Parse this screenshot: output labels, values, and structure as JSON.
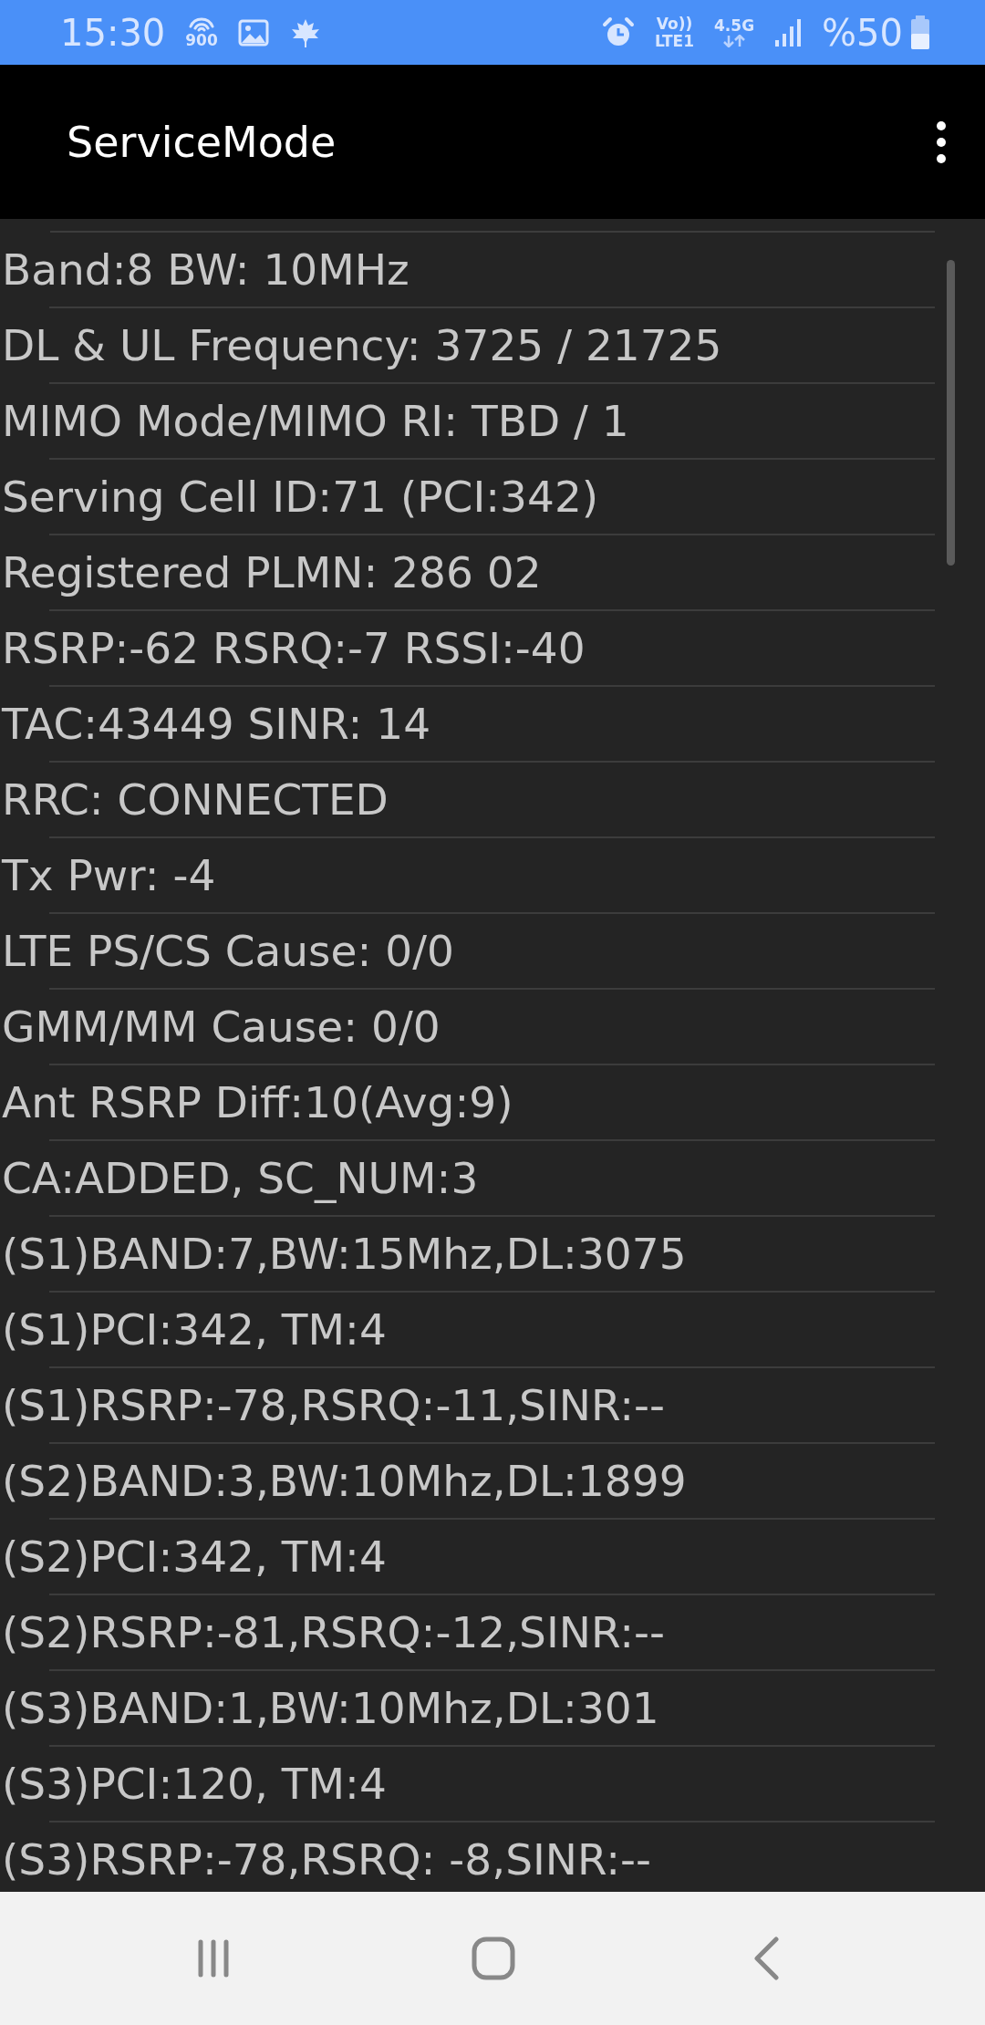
{
  "status_bar": {
    "time": "15:30",
    "network_label": "900",
    "volte_label": "Vo))",
    "lte_label": "LTE1",
    "data_label": "4.5G",
    "battery": "%50"
  },
  "app_bar": {
    "title": "ServiceMode"
  },
  "lines": [
    "Band:8 BW: 10MHz",
    "DL & UL Frequency: 3725 / 21725",
    "MIMO Mode/MIMO RI: TBD / 1",
    "Serving Cell ID:71 (PCI:342)",
    "Registered PLMN: 286 02",
    "RSRP:-62 RSRQ:-7 RSSI:-40",
    "TAC:43449 SINR: 14",
    "RRC: CONNECTED",
    "Tx Pwr: -4",
    "LTE PS/CS Cause: 0/0",
    "GMM/MM Cause: 0/0",
    "Ant RSRP Diff:10(Avg:9)",
    "CA:ADDED, SC_NUM:3",
    "(S1)BAND:7,BW:15Mhz,DL:3075",
    "(S1)PCI:342, TM:4",
    "(S1)RSRP:-78,RSRQ:-11,SINR:--",
    "(S2)BAND:3,BW:10Mhz,DL:1899",
    "(S2)PCI:342, TM:4",
    "(S2)RSRP:-81,RSRQ:-12,SINR:--",
    "(S3)BAND:1,BW:10Mhz,DL:301",
    "(S3)PCI:120, TM:4",
    "(S3)RSRP:-78,RSRQ: -8,SINR:--"
  ]
}
